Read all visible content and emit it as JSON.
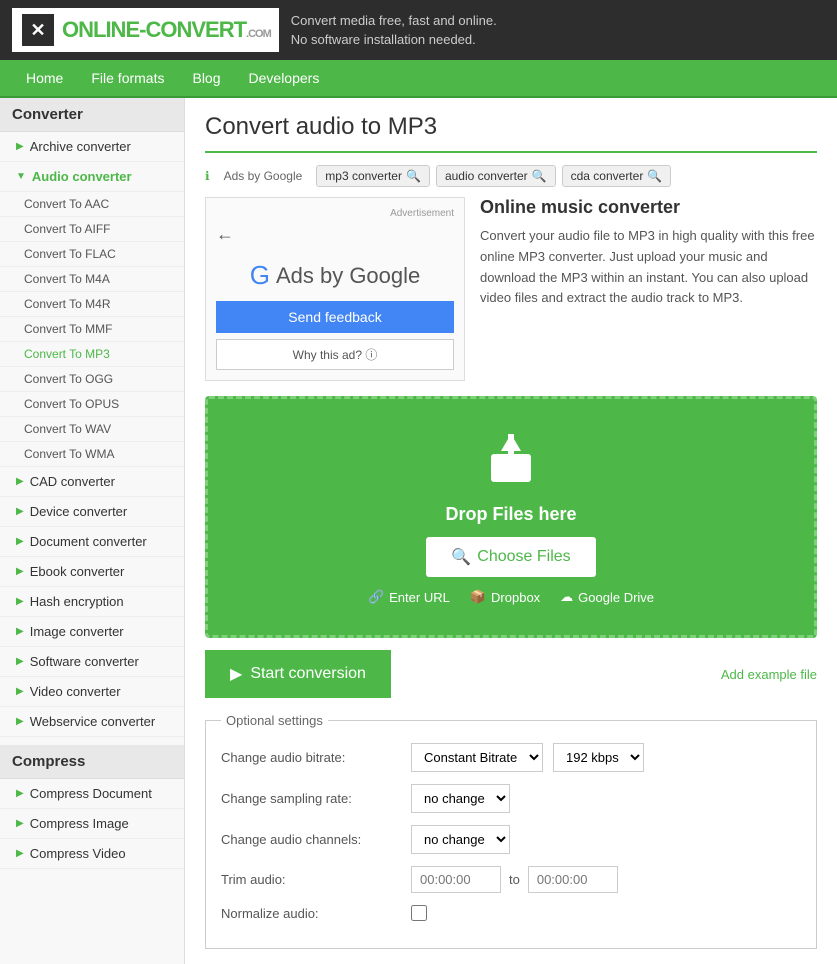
{
  "header": {
    "logo_text1": "ONLINE-",
    "logo_text2": "CONVERT",
    "logo_com": ".COM",
    "tagline_line1": "Convert media free, fast and online.",
    "tagline_line2": "No software installation needed."
  },
  "nav": {
    "items": [
      "Home",
      "File formats",
      "Blog",
      "Developers"
    ]
  },
  "sidebar": {
    "section1_title": "Converter",
    "items": [
      {
        "label": "Archive converter",
        "has_arrow": true,
        "active": false
      },
      {
        "label": "Audio converter",
        "has_arrow": true,
        "active": true,
        "expanded": true
      },
      {
        "label": "CAD converter",
        "has_arrow": true,
        "active": false
      },
      {
        "label": "Device converter",
        "has_arrow": true,
        "active": false
      },
      {
        "label": "Document converter",
        "has_arrow": true,
        "active": false
      },
      {
        "label": "Ebook converter",
        "has_arrow": true,
        "active": false
      },
      {
        "label": "Hash encryption",
        "has_arrow": true,
        "active": false
      },
      {
        "label": "Image converter",
        "has_arrow": true,
        "active": false
      },
      {
        "label": "Software converter",
        "has_arrow": true,
        "active": false
      },
      {
        "label": "Video converter",
        "has_arrow": true,
        "active": false
      },
      {
        "label": "Webservice converter",
        "has_arrow": true,
        "active": false
      }
    ],
    "subitems": [
      "Convert To AAC",
      "Convert To AIFF",
      "Convert To FLAC",
      "Convert To M4A",
      "Convert To M4R",
      "Convert To MMF",
      "Convert To MP3",
      "Convert To OGG",
      "Convert To OPUS",
      "Convert To WAV",
      "Convert To WMA"
    ],
    "section2_title": "Compress",
    "compress_items": [
      {
        "label": "Compress Document",
        "has_arrow": true
      },
      {
        "label": "Compress Image",
        "has_arrow": true
      },
      {
        "label": "Compress Video",
        "has_arrow": true
      }
    ]
  },
  "content": {
    "page_title": "Convert audio to MP3",
    "breadcrumb": {
      "info_icon": "ℹ",
      "ads_label": "Ads by Google",
      "tags": [
        "mp3 converter",
        "audio converter",
        "cda converter"
      ]
    },
    "ad": {
      "advertisement_label": "Advertisement",
      "ads_by_google": "Ads by Google",
      "send_feedback_label": "Send feedback",
      "why_this_ad_label": "Why this ad? ⓘ"
    },
    "description": {
      "title": "Online music converter",
      "text": "Convert your audio file to MP3 in high quality with this free online MP3 converter. Just upload your music and download the MP3 within an instant. You can also upload video files and extract the audio track to MP3."
    },
    "upload": {
      "drop_text": "Drop Files here",
      "choose_files": "Choose Files",
      "enter_url": "Enter URL",
      "dropbox": "Dropbox",
      "google_drive": "Google Drive"
    },
    "start_button_label": "Start conversion",
    "add_example_label": "Add example file",
    "optional_settings": {
      "legend": "Optional settings",
      "rows": [
        {
          "label": "Change audio bitrate:",
          "type": "double_select",
          "options1": [
            "Constant Bitrate"
          ],
          "options2": [
            "192 kbps"
          ],
          "value1": "Constant Bitrate",
          "value2": "192 kbps"
        },
        {
          "label": "Change sampling rate:",
          "type": "select",
          "options": [
            "no change"
          ],
          "value": "no change"
        },
        {
          "label": "Change audio channels:",
          "type": "select",
          "options": [
            "no change"
          ],
          "value": "no change"
        },
        {
          "label": "Trim audio:",
          "type": "trim",
          "from_placeholder": "00:00:00",
          "to_placeholder": "00:00:00",
          "to_label": "to"
        },
        {
          "label": "Normalize audio:",
          "type": "checkbox"
        }
      ]
    }
  }
}
